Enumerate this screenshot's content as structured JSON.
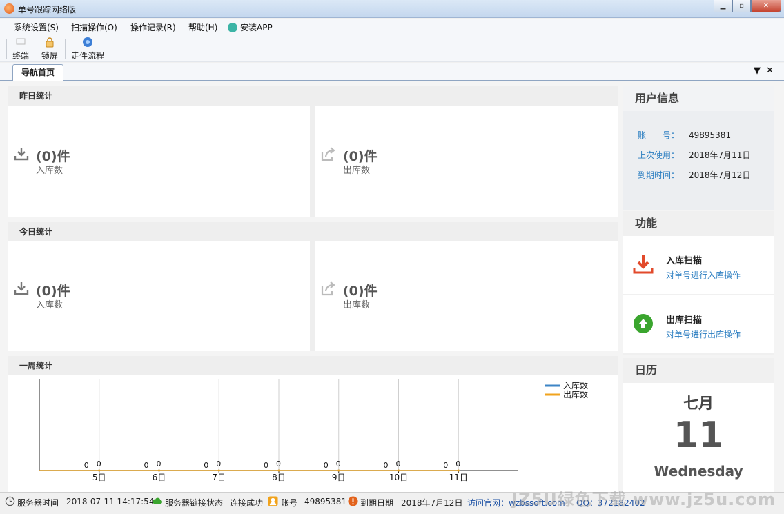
{
  "window": {
    "title": "单号跟踪网络版"
  },
  "menu": [
    {
      "label": "系统设置(S)"
    },
    {
      "label": "扫描操作(O)"
    },
    {
      "label": "操作记录(R)"
    },
    {
      "label": "帮助(H)"
    },
    {
      "label": "安装APP"
    }
  ],
  "toolbar": {
    "terminal": "终端",
    "lock": "锁屏",
    "flow": "走件流程"
  },
  "tabs": {
    "home": "导航首页"
  },
  "yesterday": {
    "title": "昨日统计",
    "in_count": "(0)件",
    "in_label": "入库数",
    "out_count": "(0)件",
    "out_label": "出库数"
  },
  "today": {
    "title": "今日统计",
    "in_count": "(0)件",
    "in_label": "入库数",
    "out_count": "(0)件",
    "out_label": "出库数"
  },
  "chart_data": {
    "type": "line",
    "title": "一周统计",
    "categories": [
      "5日",
      "6日",
      "7日",
      "8日",
      "9日",
      "10日",
      "11日"
    ],
    "series": [
      {
        "name": "入库数",
        "values": [
          0,
          0,
          0,
          0,
          0,
          0,
          0
        ],
        "color": "#3d85c6"
      },
      {
        "name": "出库数",
        "values": [
          0,
          0,
          0,
          0,
          0,
          0,
          0
        ],
        "color": "#f0a31e"
      }
    ],
    "ylim": [
      0,
      1
    ],
    "grid": true,
    "legend": "top-right"
  },
  "user": {
    "title": "用户信息",
    "account_key": "账　　号：",
    "account": "49895381",
    "last_key": "上次使用：",
    "last": "2018年7月11日",
    "expire_key": "到期时间：",
    "expire": "2018年7月12日"
  },
  "functions": {
    "title": "功能",
    "in_title": "入库扫描",
    "in_desc": "对单号进行入库操作",
    "out_title": "出库扫描",
    "out_desc": "对单号进行出库操作"
  },
  "calendar": {
    "title": "日历",
    "month": "七月",
    "day": "11",
    "weekday": "Wednesday"
  },
  "status": {
    "server_time_label": "服务器时间",
    "server_time": "2018-07-11 14:17:54",
    "conn_label": "服务器链接状态",
    "conn": "连接成功",
    "account_label": "账号",
    "account": "49895381",
    "expire_label": "到期日期",
    "expire": "2018年7月12日",
    "website": "访问官网：wzbssoft.com",
    "qq": "QQ：372182402"
  },
  "watermark": "JZ5U绿色下载 www.jz5u.com",
  "colors": {
    "accent": "#2b7ec1",
    "in_icon": "#e24a2b",
    "out_icon": "#3aa52e",
    "line_in": "#3d85c6",
    "line_out": "#f0a31e"
  }
}
